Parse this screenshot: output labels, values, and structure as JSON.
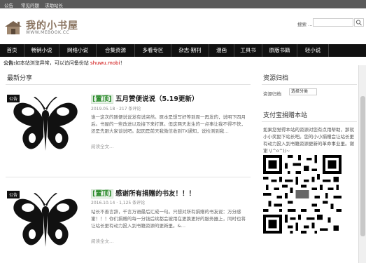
{
  "topbar": {
    "links": [
      "公告",
      "常见问题",
      "求助站长"
    ]
  },
  "header": {
    "logo_title": "我的小书屋",
    "logo_sub": "WWW.MEBOOK.CC",
    "search_label": "搜索 …",
    "search_placeholder": ""
  },
  "nav": {
    "items": [
      "首页",
      "畅销小说",
      "网络小说",
      "合集资源",
      "多看专区",
      "杂志·期刊",
      "漫画",
      "工具书",
      "原版书籍",
      "轻小说"
    ]
  },
  "notice": {
    "prefix": "公告:",
    "text": "如本站浏览异常，可以访问备份站 ",
    "link": "shuwu.mobi",
    "suffix": "！"
  },
  "main": {
    "section_title": "最新分享",
    "posts": [
      {
        "tag": "公告",
        "badge": "[置顶]",
        "title": "五月赞便说说（5.19更新）",
        "meta": "2019.05.18 · 217 条评论",
        "excerpt": "谁一这次的随便说说发有说突然。原本是想写好等到周一再发的，说明下四月后。书屋的一些改进以及接下来打算。但这两天发生的一点事让我不得不快，还是先跟大家谈说吧。起因是前天我微信收到TX通知，说检测到我…",
        "readmore": "阅读全文…"
      },
      {
        "tag": "公告",
        "badge": "[置顶]",
        "title": "感谢所有捐赠的书友！！！",
        "meta": "2016.10.14 · 1,125 条评论",
        "excerpt": "站长不善言辞，千言万语最后汇成一句。只想对所有捐赠的书友说：万分感谢！！！你们捐赠的每一分钱后续都会被用在更换更好的服务器上，同时也将让站长更有动力投入到书籍资源的更新里。&…",
        "readmore": "阅读全文…"
      }
    ]
  },
  "sidebar": {
    "archive_title": "资源归档",
    "archive_label": "资源归档",
    "archive_select": "选择分类",
    "donate_title": "支付宝捐赠本站",
    "donate_text": "如果您觉得本站的资源对您有点用帮助，那就小小奖励下站长吧。您的小小捐赠会让站长更有动力投入到书籍资源更新的革命事业里。谢谢 \\(^o^)/~"
  },
  "colors": {
    "nav_bg": "#111111",
    "badge_green": "#2a8a2a",
    "link_red": "#cc0000"
  }
}
